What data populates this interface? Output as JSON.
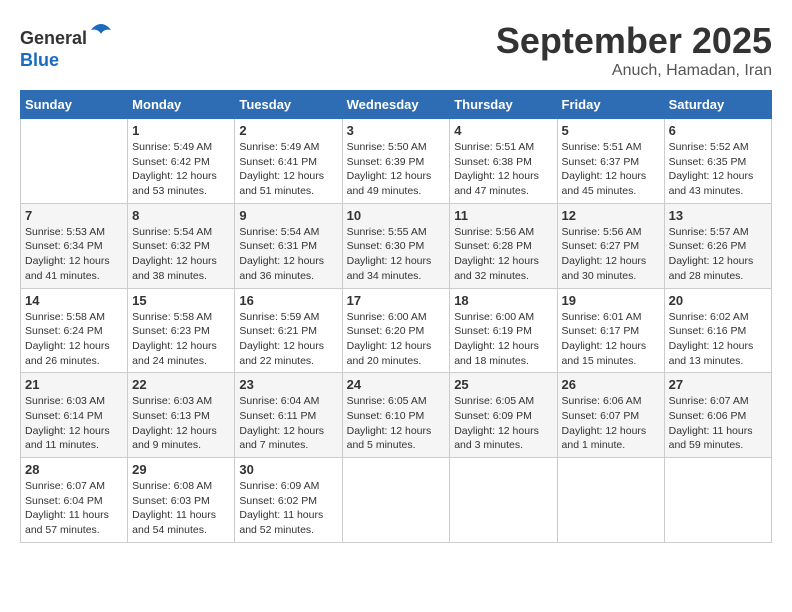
{
  "header": {
    "logo_line1": "General",
    "logo_line2": "Blue",
    "month": "September 2025",
    "location": "Anuch, Hamadan, Iran"
  },
  "weekdays": [
    "Sunday",
    "Monday",
    "Tuesday",
    "Wednesday",
    "Thursday",
    "Friday",
    "Saturday"
  ],
  "weeks": [
    [
      {
        "day": "",
        "sunrise": "",
        "sunset": "",
        "daylight": ""
      },
      {
        "day": "1",
        "sunrise": "Sunrise: 5:49 AM",
        "sunset": "Sunset: 6:42 PM",
        "daylight": "Daylight: 12 hours and 53 minutes."
      },
      {
        "day": "2",
        "sunrise": "Sunrise: 5:49 AM",
        "sunset": "Sunset: 6:41 PM",
        "daylight": "Daylight: 12 hours and 51 minutes."
      },
      {
        "day": "3",
        "sunrise": "Sunrise: 5:50 AM",
        "sunset": "Sunset: 6:39 PM",
        "daylight": "Daylight: 12 hours and 49 minutes."
      },
      {
        "day": "4",
        "sunrise": "Sunrise: 5:51 AM",
        "sunset": "Sunset: 6:38 PM",
        "daylight": "Daylight: 12 hours and 47 minutes."
      },
      {
        "day": "5",
        "sunrise": "Sunrise: 5:51 AM",
        "sunset": "Sunset: 6:37 PM",
        "daylight": "Daylight: 12 hours and 45 minutes."
      },
      {
        "day": "6",
        "sunrise": "Sunrise: 5:52 AM",
        "sunset": "Sunset: 6:35 PM",
        "daylight": "Daylight: 12 hours and 43 minutes."
      }
    ],
    [
      {
        "day": "7",
        "sunrise": "Sunrise: 5:53 AM",
        "sunset": "Sunset: 6:34 PM",
        "daylight": "Daylight: 12 hours and 41 minutes."
      },
      {
        "day": "8",
        "sunrise": "Sunrise: 5:54 AM",
        "sunset": "Sunset: 6:32 PM",
        "daylight": "Daylight: 12 hours and 38 minutes."
      },
      {
        "day": "9",
        "sunrise": "Sunrise: 5:54 AM",
        "sunset": "Sunset: 6:31 PM",
        "daylight": "Daylight: 12 hours and 36 minutes."
      },
      {
        "day": "10",
        "sunrise": "Sunrise: 5:55 AM",
        "sunset": "Sunset: 6:30 PM",
        "daylight": "Daylight: 12 hours and 34 minutes."
      },
      {
        "day": "11",
        "sunrise": "Sunrise: 5:56 AM",
        "sunset": "Sunset: 6:28 PM",
        "daylight": "Daylight: 12 hours and 32 minutes."
      },
      {
        "day": "12",
        "sunrise": "Sunrise: 5:56 AM",
        "sunset": "Sunset: 6:27 PM",
        "daylight": "Daylight: 12 hours and 30 minutes."
      },
      {
        "day": "13",
        "sunrise": "Sunrise: 5:57 AM",
        "sunset": "Sunset: 6:26 PM",
        "daylight": "Daylight: 12 hours and 28 minutes."
      }
    ],
    [
      {
        "day": "14",
        "sunrise": "Sunrise: 5:58 AM",
        "sunset": "Sunset: 6:24 PM",
        "daylight": "Daylight: 12 hours and 26 minutes."
      },
      {
        "day": "15",
        "sunrise": "Sunrise: 5:58 AM",
        "sunset": "Sunset: 6:23 PM",
        "daylight": "Daylight: 12 hours and 24 minutes."
      },
      {
        "day": "16",
        "sunrise": "Sunrise: 5:59 AM",
        "sunset": "Sunset: 6:21 PM",
        "daylight": "Daylight: 12 hours and 22 minutes."
      },
      {
        "day": "17",
        "sunrise": "Sunrise: 6:00 AM",
        "sunset": "Sunset: 6:20 PM",
        "daylight": "Daylight: 12 hours and 20 minutes."
      },
      {
        "day": "18",
        "sunrise": "Sunrise: 6:00 AM",
        "sunset": "Sunset: 6:19 PM",
        "daylight": "Daylight: 12 hours and 18 minutes."
      },
      {
        "day": "19",
        "sunrise": "Sunrise: 6:01 AM",
        "sunset": "Sunset: 6:17 PM",
        "daylight": "Daylight: 12 hours and 15 minutes."
      },
      {
        "day": "20",
        "sunrise": "Sunrise: 6:02 AM",
        "sunset": "Sunset: 6:16 PM",
        "daylight": "Daylight: 12 hours and 13 minutes."
      }
    ],
    [
      {
        "day": "21",
        "sunrise": "Sunrise: 6:03 AM",
        "sunset": "Sunset: 6:14 PM",
        "daylight": "Daylight: 12 hours and 11 minutes."
      },
      {
        "day": "22",
        "sunrise": "Sunrise: 6:03 AM",
        "sunset": "Sunset: 6:13 PM",
        "daylight": "Daylight: 12 hours and 9 minutes."
      },
      {
        "day": "23",
        "sunrise": "Sunrise: 6:04 AM",
        "sunset": "Sunset: 6:11 PM",
        "daylight": "Daylight: 12 hours and 7 minutes."
      },
      {
        "day": "24",
        "sunrise": "Sunrise: 6:05 AM",
        "sunset": "Sunset: 6:10 PM",
        "daylight": "Daylight: 12 hours and 5 minutes."
      },
      {
        "day": "25",
        "sunrise": "Sunrise: 6:05 AM",
        "sunset": "Sunset: 6:09 PM",
        "daylight": "Daylight: 12 hours and 3 minutes."
      },
      {
        "day": "26",
        "sunrise": "Sunrise: 6:06 AM",
        "sunset": "Sunset: 6:07 PM",
        "daylight": "Daylight: 12 hours and 1 minute."
      },
      {
        "day": "27",
        "sunrise": "Sunrise: 6:07 AM",
        "sunset": "Sunset: 6:06 PM",
        "daylight": "Daylight: 11 hours and 59 minutes."
      }
    ],
    [
      {
        "day": "28",
        "sunrise": "Sunrise: 6:07 AM",
        "sunset": "Sunset: 6:04 PM",
        "daylight": "Daylight: 11 hours and 57 minutes."
      },
      {
        "day": "29",
        "sunrise": "Sunrise: 6:08 AM",
        "sunset": "Sunset: 6:03 PM",
        "daylight": "Daylight: 11 hours and 54 minutes."
      },
      {
        "day": "30",
        "sunrise": "Sunrise: 6:09 AM",
        "sunset": "Sunset: 6:02 PM",
        "daylight": "Daylight: 11 hours and 52 minutes."
      },
      {
        "day": "",
        "sunrise": "",
        "sunset": "",
        "daylight": ""
      },
      {
        "day": "",
        "sunrise": "",
        "sunset": "",
        "daylight": ""
      },
      {
        "day": "",
        "sunrise": "",
        "sunset": "",
        "daylight": ""
      },
      {
        "day": "",
        "sunrise": "",
        "sunset": "",
        "daylight": ""
      }
    ]
  ]
}
